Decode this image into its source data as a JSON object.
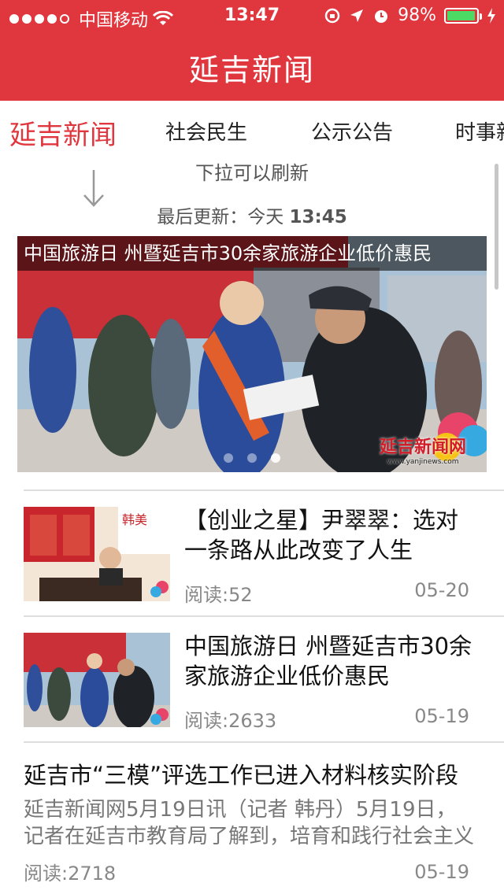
{
  "status_bar": {
    "carrier": "中国移动",
    "time": "13:47",
    "battery_percent": "98%",
    "battery_level": 0.98,
    "icons": [
      "signal-dots-icon",
      "wifi-icon",
      "rotation-lock-icon",
      "location-icon",
      "alarm-icon",
      "battery-icon",
      "charging-icon"
    ]
  },
  "header": {
    "title": "延吉新闻"
  },
  "tabs": [
    {
      "label": "延吉新闻",
      "active": true
    },
    {
      "label": "社会民生",
      "active": false
    },
    {
      "label": "公示公告",
      "active": false
    },
    {
      "label": "时事新"
    }
  ],
  "refresh": {
    "hint": "下拉可以刷新",
    "updated_label": "最后更新：今天",
    "updated_time": "13:45"
  },
  "banner": {
    "caption": "中国旅游日 州暨延吉市30余家旅游企业低价惠民",
    "watermark": "延吉新闻网",
    "watermark_url": "www.yanjinews.com",
    "page_count": 3,
    "current_page": 3
  },
  "news": [
    {
      "title": "【创业之星】尹翠翠：选对一条路从此改变了人生",
      "reads": "阅读:52",
      "date": "05-20"
    },
    {
      "title": "中国旅游日 州暨延吉市30余家旅游企业低价惠民",
      "reads": "阅读:2633",
      "date": "05-19"
    }
  ],
  "text_news": {
    "title": "延吉市“三模”评选工作已进入材料核实阶段",
    "summary": " 延吉新闻网5月19日讯（记者 韩丹）5月19日，记者在延吉市教育局了解到，培育和践行社会主义核心价值观",
    "reads": "阅读:2718",
    "date": "05-19"
  },
  "colors": {
    "brand": "#e0363e",
    "battery": "#4cd964"
  }
}
